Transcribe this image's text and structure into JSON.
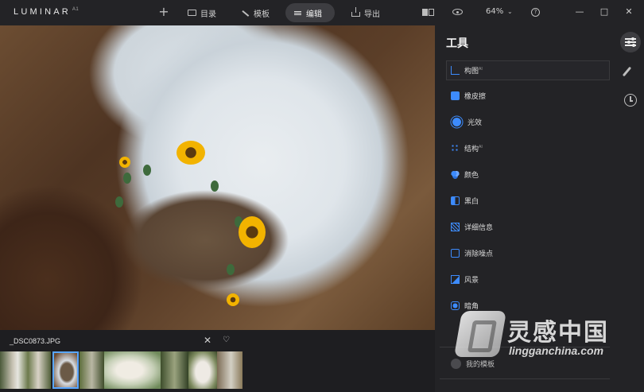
{
  "app": {
    "logo_text": "LUMINAR",
    "logo_version": "A1"
  },
  "topbar": {
    "add_label": "+",
    "tabs": [
      {
        "label": "目录",
        "icon": "folder-icon"
      },
      {
        "label": "模板",
        "icon": "magic-wand-icon"
      },
      {
        "label": "编辑",
        "icon": "sliders-icon",
        "active": true
      },
      {
        "label": "导出",
        "icon": "export-icon"
      }
    ],
    "zoom": "64%",
    "help_label": "?",
    "window_min": "—",
    "window_max": "□",
    "window_close": "✕"
  },
  "tools_panel": {
    "title": "工具",
    "tools": [
      {
        "label": "构图",
        "ai": "AI",
        "icon": "crop-icon"
      },
      {
        "label": "橡皮擦",
        "ai": "",
        "icon": "eraser-icon"
      },
      {
        "label": "光效",
        "ai": "",
        "icon": "sun-icon"
      },
      {
        "label": "结构",
        "ai": "AI",
        "icon": "structure-icon"
      },
      {
        "label": "颜色",
        "ai": "",
        "icon": "color-icon"
      },
      {
        "label": "黑白",
        "ai": "",
        "icon": "black-white-icon"
      },
      {
        "label": "详细信息",
        "ai": "",
        "icon": "details-icon"
      },
      {
        "label": "消除噪点",
        "ai": "",
        "icon": "denoise-icon"
      },
      {
        "label": "风景",
        "ai": "",
        "icon": "landscape-icon"
      },
      {
        "label": "暗角",
        "ai": "",
        "icon": "vignette-icon"
      }
    ],
    "my_presets_label": "我的模板"
  },
  "filmstrip": {
    "file_name": "_DSC0873.JPG",
    "close_label": "✕",
    "favorite_label": "♡",
    "thumbnail_count": 7,
    "selected_index": 1
  },
  "watermark": {
    "cn_text": "灵感中国",
    "en_text": "lingganchina.com"
  },
  "colors": {
    "accent": "#3d8bfd",
    "panel_bg": "#232326",
    "selected_thumb": "#5aa7ff"
  }
}
